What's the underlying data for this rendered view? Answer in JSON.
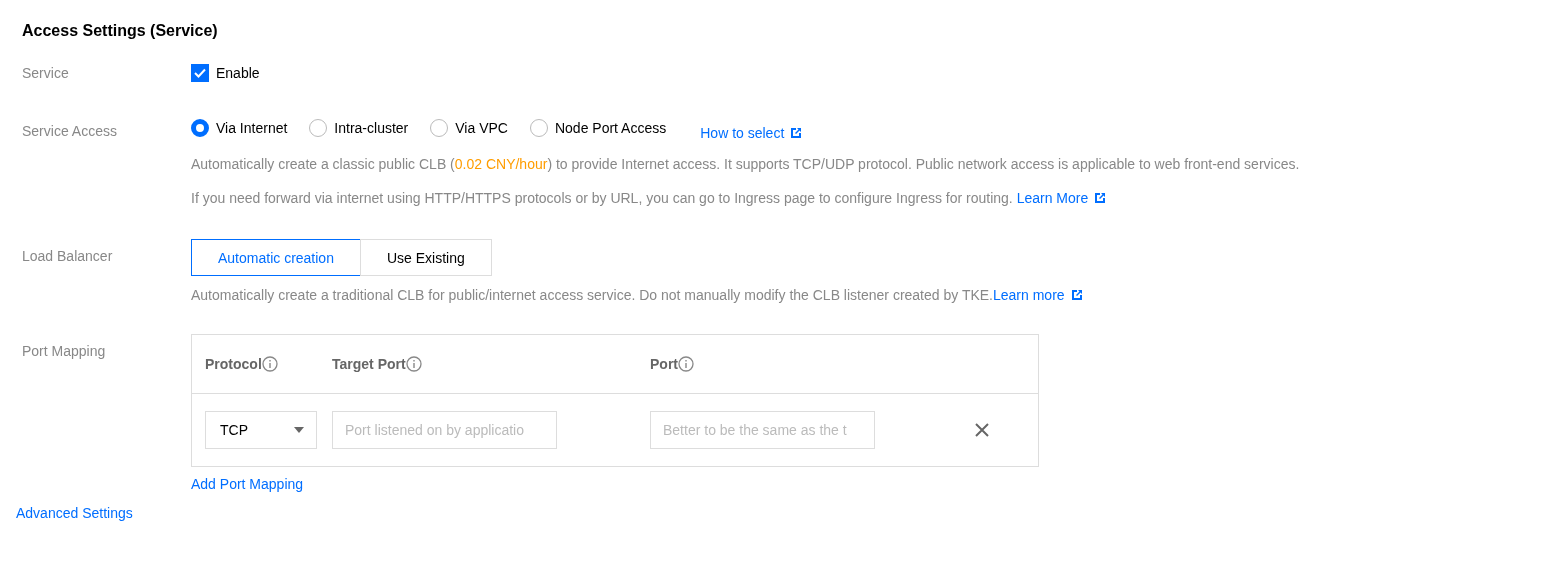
{
  "section_title": "Access Settings (Service)",
  "service": {
    "label": "Service",
    "checkbox": {
      "label": "Enable",
      "checked": true
    }
  },
  "service_access": {
    "label": "Service Access",
    "options": [
      {
        "label": "Via Internet",
        "selected": true
      },
      {
        "label": "Intra-cluster",
        "selected": false
      },
      {
        "label": "Via VPC",
        "selected": false
      },
      {
        "label": "Node Port Access",
        "selected": false
      }
    ],
    "help_link": "How to select",
    "note_1": {
      "before": "Automatically create a classic public CLB (",
      "price": "0.02 CNY/hour",
      "after": ") to provide Internet access. It supports TCP/UDP protocol. Public network access is applicable to web front-end services."
    },
    "note_2": {
      "text": "If you need forward via internet using HTTP/HTTPS protocols or by URL, you can go to Ingress page to configure Ingress for routing.",
      "link": "Learn More"
    }
  },
  "load_balancer": {
    "label": "Load Balancer",
    "options": [
      {
        "label": "Automatic creation",
        "selected": true
      },
      {
        "label": "Use Existing",
        "selected": false
      }
    ],
    "note": {
      "text": "Automatically create a traditional CLB for public/internet access service. Do not manually modify the CLB listener created by TKE.",
      "link": "Learn more"
    }
  },
  "port_mapping": {
    "label": "Port Mapping",
    "columns": [
      {
        "label": "Protocol"
      },
      {
        "label": "Target Port"
      },
      {
        "label": "Port"
      }
    ],
    "rows": [
      {
        "protocol": "TCP",
        "target_port_placeholder": "Port listened on by applicatio",
        "port_placeholder": "Better to be the same as the t"
      }
    ],
    "add_link": "Add Port Mapping"
  },
  "advanced_link": "Advanced Settings"
}
